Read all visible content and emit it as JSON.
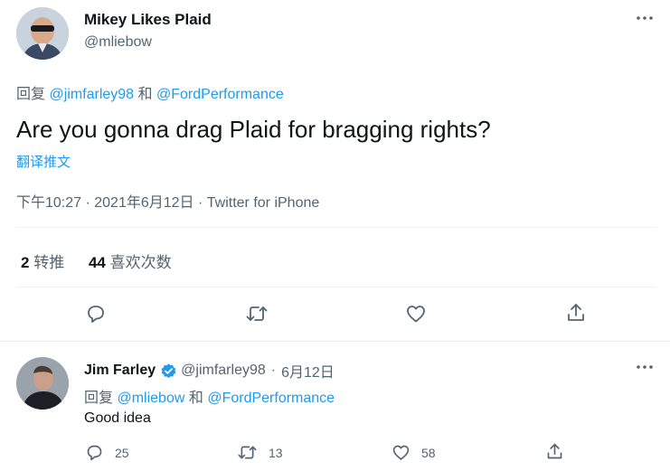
{
  "main_tweet": {
    "author_name": "Mikey Likes Plaid",
    "author_handle": "@mliebow",
    "reply_prefix": "回复",
    "reply_to_1": "@jimfarley98",
    "reply_and": "和",
    "reply_to_2": "@FordPerformance",
    "text": "Are you gonna drag Plaid for bragging rights?",
    "translate_label": "翻译推文",
    "timestamp": "下午10:27 · 2021年6月12日 · Twitter for iPhone",
    "retweets_count": "2",
    "retweets_label": "转推",
    "likes_count": "44",
    "likes_label": "喜欢次数"
  },
  "reply_tweet": {
    "author_name": "Jim Farley",
    "author_handle": "@jimfarley98",
    "date_sep": "·",
    "date": "6月12日",
    "reply_prefix": "回复",
    "reply_to_1": "@mliebow",
    "reply_and": "和",
    "reply_to_2": "@FordPerformance",
    "text": "Good idea",
    "replies": "25",
    "retweets": "13",
    "likes": "58"
  },
  "colors": {
    "link": "#1d9bf0",
    "muted": "#536471",
    "text": "#0f1419",
    "verified": "#1d9bf0"
  },
  "icons": {
    "reply": "reply-icon",
    "retweet": "retweet-icon",
    "like": "heart-icon",
    "share": "share-icon",
    "more": "more-icon",
    "verified": "verified-badge-icon"
  }
}
